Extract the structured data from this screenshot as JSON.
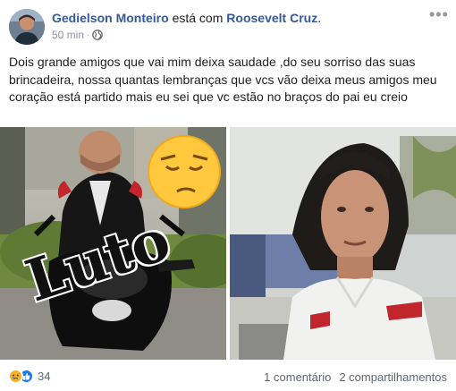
{
  "post": {
    "author": "Gedielson Monteiro",
    "with_text": " está com ",
    "tagged": "Roosevelt Cruz",
    "period": ".",
    "time": "50 min",
    "separator": "·",
    "more_label": "•••",
    "privacy_icon": "globe-icon",
    "text": "Dois grande amigos que vai mim deixa saudade ,do seu sorriso das suas brincadeira, nossa quantas lembranças que vcs vão deixa meus amigos meu coração está partido mais eu sei que vc estão no braços do pai eu creio"
  },
  "photos": {
    "left": {
      "overlay_text": "Luto",
      "emoji": "pensive-face"
    },
    "right": {
      "description_icon": "portrait-photo"
    }
  },
  "footer": {
    "reaction_icons": [
      "sad-reaction-icon",
      "like-reaction-icon"
    ],
    "reaction_count": "34",
    "comments": "1 comentário",
    "shares": "2 compartilhamentos"
  },
  "colors": {
    "link": "#385898",
    "meta": "#90949c",
    "text": "#1c1e21",
    "like_blue": "#1877f2",
    "sad_yellow": "#f7b125"
  }
}
